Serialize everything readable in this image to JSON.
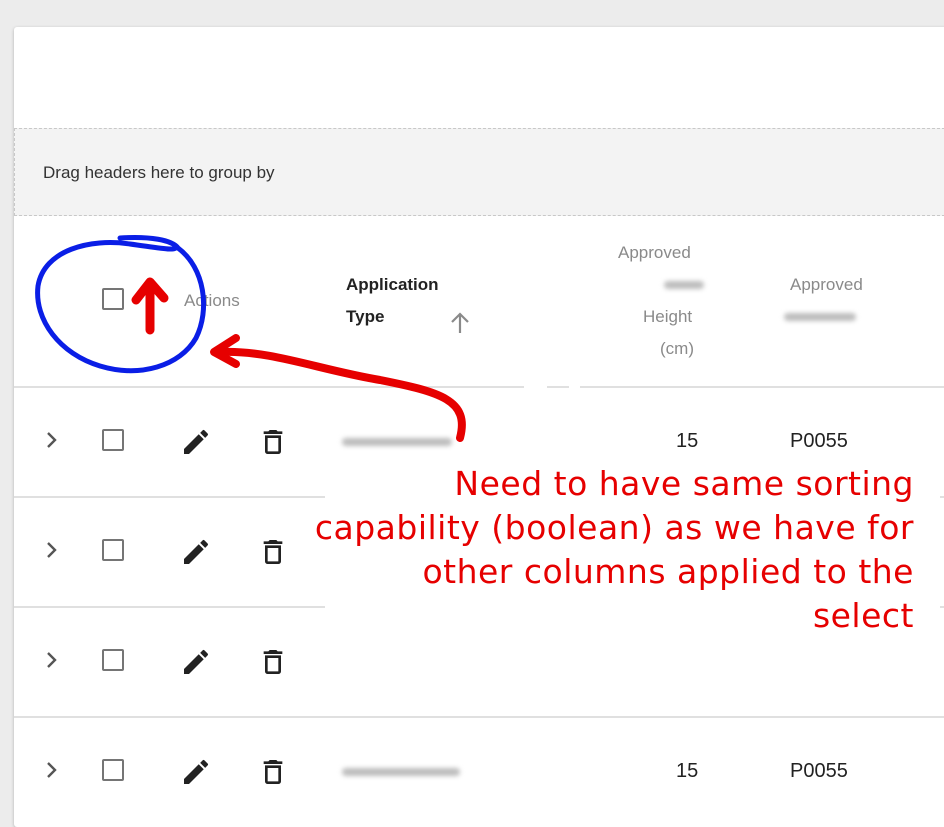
{
  "group_panel": {
    "text": "Drag headers here to group by"
  },
  "header": {
    "actions_label": "Actions",
    "application_type_line1": "Application",
    "application_type_line2": "Type",
    "approved_height_line1": "Approved",
    "approved_height_line3": "Height",
    "approved_height_line4": "(cm)",
    "approved_label": "Approved"
  },
  "rows": [
    {
      "height_cm": "15",
      "approved": "P0055"
    },
    {
      "height_cm": "",
      "approved": ""
    },
    {
      "height_cm": "",
      "approved": ""
    },
    {
      "height_cm": "15",
      "approved": "P0055"
    }
  ],
  "annotation": {
    "text": "Need to have same sorting capability (boolean) as we have for other columns applied to the select",
    "color": "#e60000",
    "circle_color": "#0a1ee6"
  },
  "icons": {
    "expand": "chevron-right-icon",
    "edit": "pencil-icon",
    "delete": "trash-icon",
    "sort": "arrow-up-icon"
  }
}
